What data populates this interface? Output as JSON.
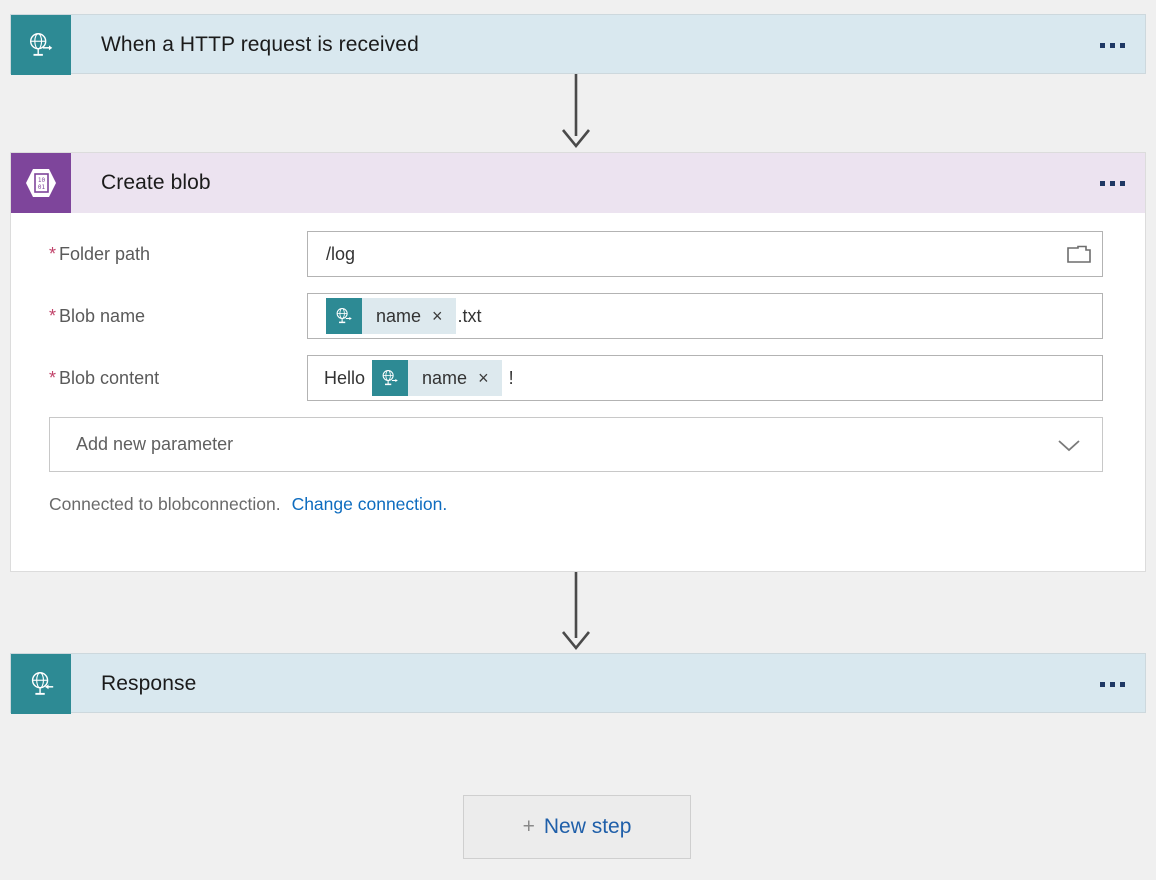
{
  "workflow": {
    "trigger": {
      "title": "When a HTTP request is received",
      "icon": "http-request-globe-icon",
      "menu": "more-options"
    },
    "action": {
      "title": "Create blob",
      "icon": "blob-binary-hexagon-icon",
      "menu": "more-options",
      "fields": [
        {
          "label": "Folder path",
          "required_marker": "*",
          "value": "/log",
          "trailing_icon": "folder-picker-icon"
        },
        {
          "label": "Blob name",
          "required_marker": "*",
          "prefix_text": "",
          "token": {
            "label": "name",
            "remove": "×",
            "icon": "dynamic-content-globe-icon"
          },
          "suffix_text": ".txt"
        },
        {
          "label": "Blob content",
          "required_marker": "*",
          "prefix_text": "Hello ",
          "token": {
            "label": "name",
            "remove": "×",
            "icon": "dynamic-content-globe-icon"
          },
          "suffix_text": " !"
        }
      ],
      "add_parameter": {
        "placeholder": "Add new parameter",
        "chevron": "chevron-down-icon"
      },
      "connection": {
        "status_text": "Connected to blobconnection.",
        "change_link": "Change connection."
      }
    },
    "response": {
      "title": "Response",
      "icon": "http-response-globe-icon",
      "menu": "more-options"
    },
    "new_step": {
      "plus": "+",
      "label": "New step"
    }
  },
  "colors": {
    "teal": "#2d8a94",
    "teal_card": "#d9e8ef",
    "purple": "#7e459b",
    "purple_header": "#ece3f0",
    "required": "#c1436a",
    "link": "#0e6cbf",
    "background": "#f0f0f0"
  }
}
